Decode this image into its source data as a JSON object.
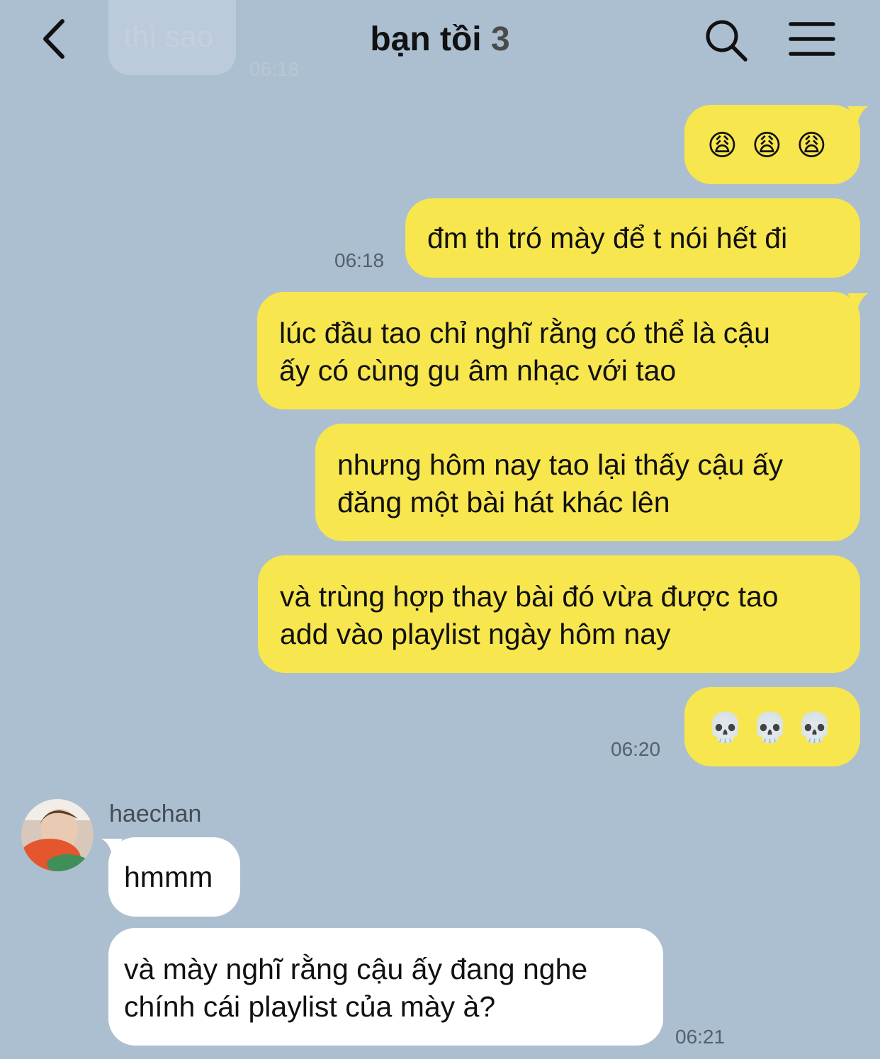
{
  "header": {
    "title": "bạn tồi",
    "member_count": "3",
    "back_icon": "chevron-left-icon",
    "search_icon": "search-icon",
    "menu_icon": "hamburger-menu-icon"
  },
  "previous": {
    "text": "thì sao",
    "time": "06:18"
  },
  "messages": [
    {
      "emoji": [
        "😩",
        "😩",
        "😩"
      ]
    },
    {
      "text": "đm th tró mày để t nói hết đi",
      "time": "06:18"
    },
    {
      "line1": "lúc đầu tao chỉ nghĩ rằng có thể là cậu",
      "line2": "ấy có cùng gu âm nhạc với tao"
    },
    {
      "line1": "nhưng hôm nay tao lại thấy cậu ấy",
      "line2": "đăng một bài hát khác lên"
    },
    {
      "line1": "và trùng hợp thay bài đó vừa được tao",
      "line2": "add vào playlist ngày hôm nay"
    },
    {
      "emoji": [
        "💀",
        "💀",
        "💀"
      ],
      "time": "06:20"
    }
  ],
  "friend": {
    "name": "haechan",
    "messages": [
      {
        "text": "hmmm"
      },
      {
        "line1": "và mày nghĩ rằng cậu ấy đang nghe",
        "line2": "chính cái playlist của mày à?",
        "time": "06:21"
      }
    ]
  },
  "colors": {
    "background": "#abbfd1",
    "my_bubble": "#f7e64e",
    "friend_bubble": "#ffffff"
  }
}
